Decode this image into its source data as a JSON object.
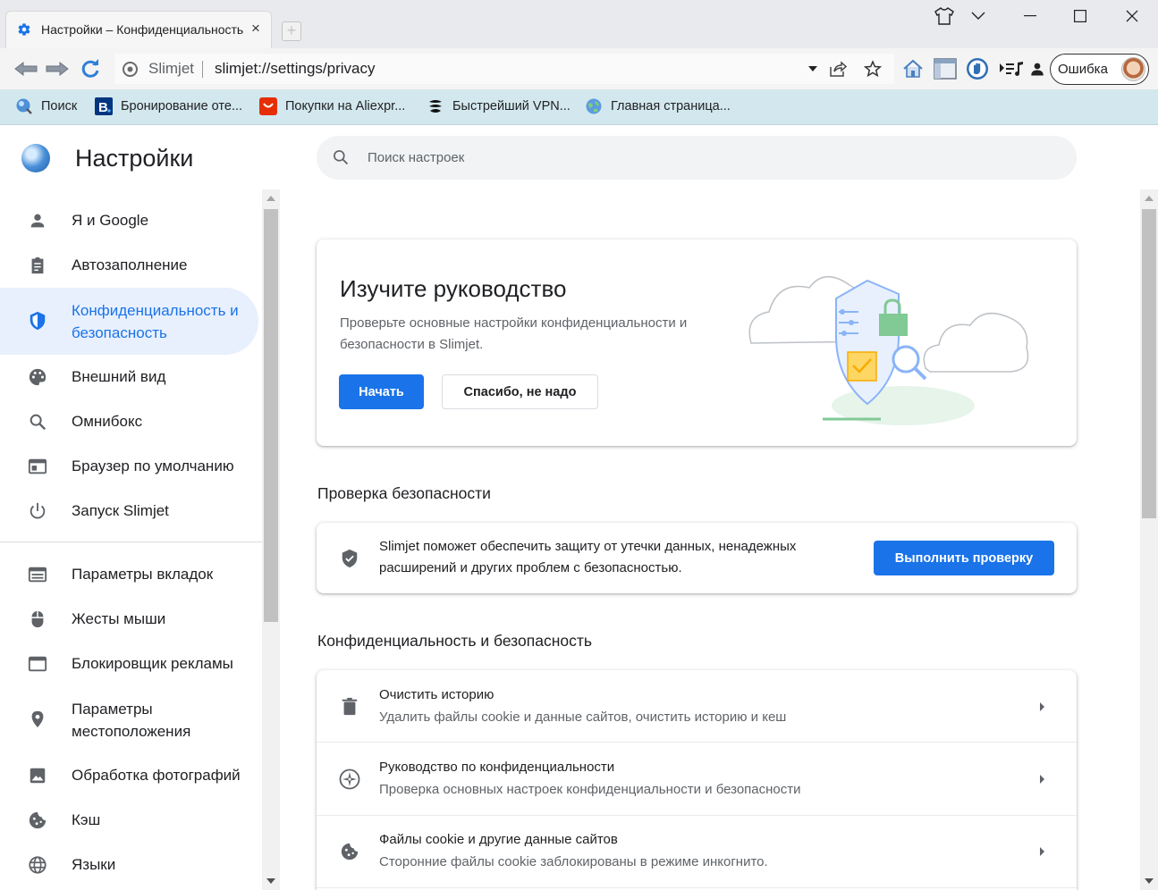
{
  "window": {
    "tab_title": "Настройки – Конфиденциальность",
    "tab_close": "×",
    "new_tab": "+"
  },
  "toolbar": {
    "site_name": "Slimjet",
    "url": "slimjet://settings/privacy",
    "profile_label": "Ошибка"
  },
  "bookmarks": [
    {
      "label": "Поиск",
      "icon": "globe-search-icon"
    },
    {
      "label": "Бронирование оте...",
      "icon": "booking-icon"
    },
    {
      "label": "Покупки на Aliexpr...",
      "icon": "aliexpress-icon"
    },
    {
      "label": "Быстрейший VPN...",
      "icon": "vpn-icon"
    },
    {
      "label": "Главная страница...",
      "icon": "globe-icon"
    }
  ],
  "settings": {
    "title": "Настройки",
    "search_placeholder": "Поиск настроек"
  },
  "sidebar": {
    "items": [
      {
        "label": "Я и Google",
        "icon": "person-icon"
      },
      {
        "label": "Автозаполнение",
        "icon": "clipboard-icon"
      },
      {
        "label": "Конфиденциальность и безопасность",
        "icon": "shield-icon",
        "active": true
      },
      {
        "label": "Внешний вид",
        "icon": "palette-icon"
      },
      {
        "label": "Омнибокс",
        "icon": "search-icon"
      },
      {
        "label": "Браузер по умолчанию",
        "icon": "browser-icon"
      },
      {
        "label": "Запуск Slimjet",
        "icon": "power-icon"
      },
      {
        "label": "Параметры вкладок",
        "icon": "tabs-icon"
      },
      {
        "label": "Жесты мыши",
        "icon": "mouse-icon"
      },
      {
        "label": "Блокировщик рекламы",
        "icon": "window-icon"
      },
      {
        "label": "Параметры местоположения",
        "icon": "location-icon"
      },
      {
        "label": "Обработка фотографий",
        "icon": "image-icon"
      },
      {
        "label": "Кэш",
        "icon": "cookie-icon"
      },
      {
        "label": "Языки",
        "icon": "globe-icon"
      }
    ]
  },
  "guide": {
    "title": "Изучите руководство",
    "description": "Проверьте основные настройки конфиденциальности и безопасности в Slimjet.",
    "start_button": "Начать",
    "dismiss_button": "Спасибо, не надо"
  },
  "safety_check": {
    "section_title": "Проверка безопасности",
    "text": "Slimjet поможет обеспечить защиту от утечки данных, ненадежных расширений и других проблем с безопасностью.",
    "button": "Выполнить проверку"
  },
  "privacy": {
    "section_title": "Конфиденциальность и безопасность",
    "rows": [
      {
        "title": "Очистить историю",
        "subtitle": "Удалить файлы cookie и данные сайтов, очистить историю и кеш",
        "icon": "trash-icon"
      },
      {
        "title": "Руководство по конфиденциальности",
        "subtitle": "Проверка основных настроек конфиденциальности и безопасности",
        "icon": "compass-icon"
      },
      {
        "title": "Файлы cookie и другие данные сайтов",
        "subtitle": "Сторонние файлы cookie заблокированы в режиме инкогнито.",
        "icon": "cookie-icon"
      }
    ]
  },
  "colors": {
    "accent": "#1a73e8",
    "active_nav_bg": "#e8f0fe",
    "bookmarks_bg": "#d3e8ee"
  }
}
